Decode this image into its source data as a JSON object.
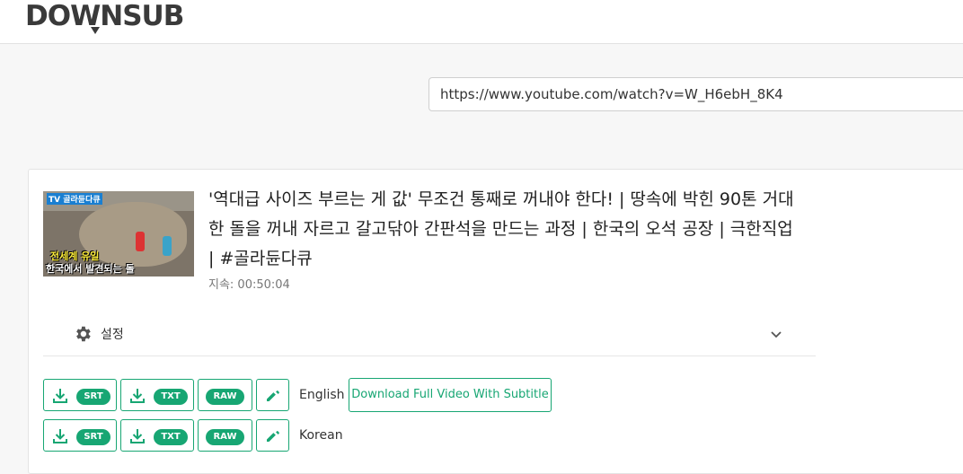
{
  "header": {
    "logo": "DOWNSUB"
  },
  "search": {
    "url_value": "https://www.youtube.com/watch?v=W_H6ebH_8K4"
  },
  "video": {
    "thumbnail": {
      "tag": "TV 골라듄다큐",
      "line1": "전세계 유일",
      "line2": "한국에서 발견되는 돌"
    },
    "title": "'역대급 사이즈 부르는 게 값' 무조건 통째로 꺼내야 한다! | 땅속에 박힌 90톤 거대한 돌을 꺼내 자르고 갈고닦아 간판석을 만드는 과정 | 한국의 오석 공장 | 극한직업 | #골라듄다큐",
    "duration": "지속: 00:50:04"
  },
  "settings": {
    "label": "설정"
  },
  "subtitles": [
    {
      "language": "English",
      "formats": [
        "SRT",
        "TXT",
        "RAW"
      ],
      "full_video_button": "Download Full Video With Subtitle"
    },
    {
      "language": "Korean",
      "formats": [
        "SRT",
        "TXT",
        "RAW"
      ]
    }
  ],
  "colors": {
    "accent": "#17a673",
    "logo": "#3a3a3a"
  }
}
